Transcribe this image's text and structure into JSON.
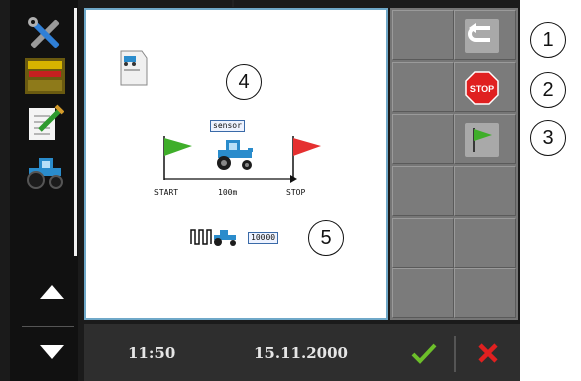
{
  "status_bar": {
    "time": "11:50",
    "date": "15.11.2000"
  },
  "main_display": {
    "sensor_label": "sensor",
    "start_label": "START",
    "distance_label": "100m",
    "stop_label": "STOP",
    "pulse_count": "10000"
  },
  "callouts": [
    "1",
    "2",
    "3",
    "4",
    "5"
  ],
  "right_softkeys": [
    {
      "icon": "return-icon"
    },
    {
      "icon": "stop-icon",
      "label": "STOP"
    },
    {
      "icon": "green-flag-icon"
    }
  ],
  "left_menu_icons": [
    "tools-icon",
    "product-icon",
    "checklist-icon",
    "tractor-icon"
  ],
  "colors": {
    "frame": "#1b1b1b",
    "softkey": "#7b7b7b",
    "accept": "#6cbf2a",
    "cancel": "#e02020",
    "flag_start": "#3fae2a",
    "flag_stop": "#e53030"
  }
}
